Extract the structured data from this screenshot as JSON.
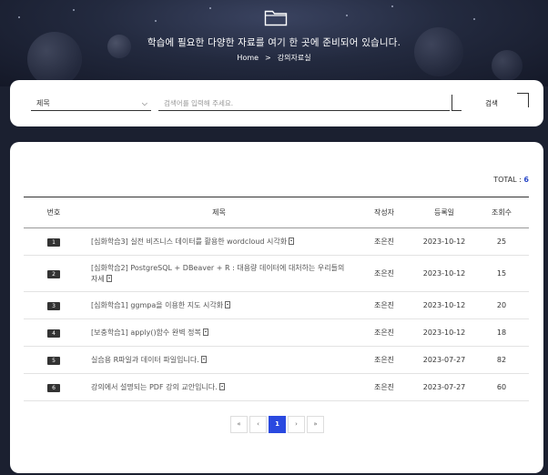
{
  "hero": {
    "title": "학습에 필요한 다양한 자료를 여기 한 곳에 준비되어 있습니다.",
    "breadcrumb": {
      "home": "Home",
      "separator": ">",
      "current": "강의자료실"
    },
    "icon": "folder-icon"
  },
  "search": {
    "select_value": "제목",
    "placeholder": "검색어를 입력해 주세요.",
    "button_label": "검색"
  },
  "list": {
    "total_label": "TOTAL : ",
    "total_count": "6",
    "columns": [
      "번호",
      "제목",
      "작성자",
      "등록일",
      "조회수"
    ],
    "rows": [
      {
        "no": "1",
        "title": "[심화학습3] 실전 비즈니스 데이터를 활용한 wordcloud 시각화",
        "author": "조은진",
        "date": "2023-10-12",
        "views": "25"
      },
      {
        "no": "2",
        "title": "[심화학습2] PostgreSQL + DBeaver + R : 대용량 데이터에 대처하는 우리들의 자세",
        "author": "조은진",
        "date": "2023-10-12",
        "views": "15"
      },
      {
        "no": "3",
        "title": "[심화학습1] ggmpa을 이용한 지도 시각화",
        "author": "조은진",
        "date": "2023-10-12",
        "views": "20"
      },
      {
        "no": "4",
        "title": "[보충학습1] apply()함수 완벽 정복",
        "author": "조은진",
        "date": "2023-10-12",
        "views": "18"
      },
      {
        "no": "5",
        "title": "실습용 R파일과 데이터 파일입니다.",
        "author": "조은진",
        "date": "2023-07-27",
        "views": "82"
      },
      {
        "no": "6",
        "title": "강의에서 설명되는 PDF 강의 교안입니다.",
        "author": "조은진",
        "date": "2023-07-27",
        "views": "60"
      }
    ]
  },
  "pagination": {
    "first": "«",
    "prev": "‹",
    "current": "1",
    "next": "›",
    "last": "»"
  },
  "colors": {
    "accent": "#2a49e0",
    "hero_bg": "#1b2030",
    "badge": "#333333"
  }
}
